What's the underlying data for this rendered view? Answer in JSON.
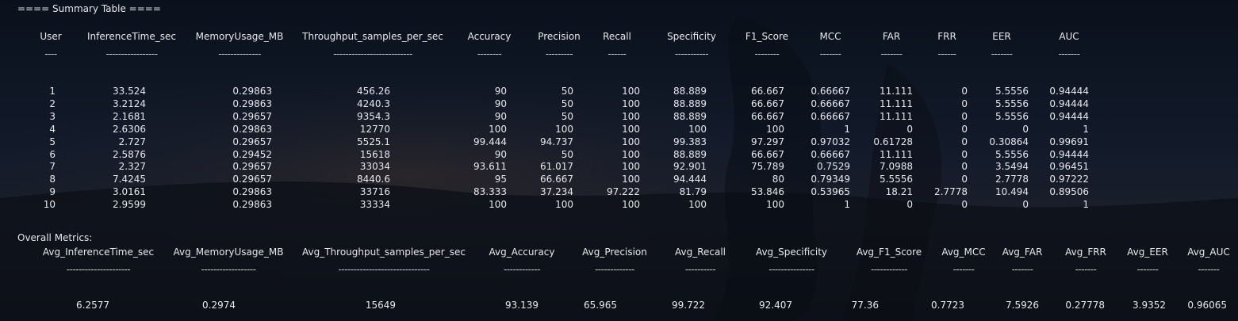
{
  "terminal": {
    "summary_header": "==== Summary Table ====",
    "overall_header": "Overall Metrics:",
    "background_color": "#0b1320",
    "text_color": "#e6e8ec"
  },
  "summary_table": {
    "columns": [
      "User",
      "InferenceTime_sec",
      "MemoryUsage_MB",
      "Throughput_samples_per_sec",
      "Accuracy",
      "Precision",
      "Recall",
      "Specificity",
      "F1_Score",
      "MCC",
      "FAR",
      "FRR",
      "EER",
      "AUC"
    ],
    "underlines": [
      "----",
      "-----------------",
      "--------------",
      "--------------------------",
      "--------",
      "---------",
      "------",
      "-----------",
      "--------",
      "-------",
      "-------",
      "------",
      "-------",
      "-------"
    ],
    "rows": [
      [
        "1",
        "33.524",
        "0.29863",
        "456.26",
        "90",
        "50",
        "100",
        "88.889",
        "66.667",
        "0.66667",
        "11.111",
        "0",
        "5.5556",
        "0.94444"
      ],
      [
        "2",
        "3.2124",
        "0.29863",
        "4240.3",
        "90",
        "50",
        "100",
        "88.889",
        "66.667",
        "0.66667",
        "11.111",
        "0",
        "5.5556",
        "0.94444"
      ],
      [
        "3",
        "2.1681",
        "0.29657",
        "9354.3",
        "90",
        "50",
        "100",
        "88.889",
        "66.667",
        "0.66667",
        "11.111",
        "0",
        "5.5556",
        "0.94444"
      ],
      [
        "4",
        "2.6306",
        "0.29863",
        "12770",
        "100",
        "100",
        "100",
        "100",
        "100",
        "1",
        "0",
        "0",
        "0",
        "1"
      ],
      [
        "5",
        "2.727",
        "0.29657",
        "5525.1",
        "99.444",
        "94.737",
        "100",
        "99.383",
        "97.297",
        "0.97032",
        "0.61728",
        "0",
        "0.30864",
        "0.99691"
      ],
      [
        "6",
        "2.5876",
        "0.29452",
        "15618",
        "90",
        "50",
        "100",
        "88.889",
        "66.667",
        "0.66667",
        "11.111",
        "0",
        "5.5556",
        "0.94444"
      ],
      [
        "7",
        "2.327",
        "0.29657",
        "33034",
        "93.611",
        "61.017",
        "100",
        "92.901",
        "75.789",
        "0.7529",
        "7.0988",
        "0",
        "3.5494",
        "0.96451"
      ],
      [
        "8",
        "7.4245",
        "0.29657",
        "8440.6",
        "95",
        "66.667",
        "100",
        "94.444",
        "80",
        "0.79349",
        "5.5556",
        "0",
        "2.7778",
        "0.97222"
      ],
      [
        "9",
        "3.0161",
        "0.29863",
        "33716",
        "83.333",
        "37.234",
        "97.222",
        "81.79",
        "53.846",
        "0.53965",
        "18.21",
        "2.7778",
        "10.494",
        "0.89506"
      ],
      [
        "10",
        "2.9599",
        "0.29863",
        "33334",
        "100",
        "100",
        "100",
        "100",
        "100",
        "1",
        "0",
        "0",
        "0",
        "1"
      ]
    ]
  },
  "overall_table": {
    "columns": [
      "Avg_InferenceTime_sec",
      "Avg_MemoryUsage_MB",
      "Avg_Throughput_samples_per_sec",
      "Avg_Accuracy",
      "Avg_Precision",
      "Avg_Recall",
      "Avg_Specificity",
      "Avg_F1_Score",
      "Avg_MCC",
      "Avg_FAR",
      "Avg_FRR",
      "Avg_EER",
      "Avg_AUC"
    ],
    "underlines": [
      "---------------------",
      "------------------",
      "------------------------------",
      "------------",
      "-------------",
      "----------",
      "---------------",
      "------------",
      "-------",
      "-------",
      "-------",
      "-------",
      "-------"
    ],
    "values": [
      "6.2577",
      "0.2974",
      "15649",
      "93.139",
      "65.965",
      "99.722",
      "92.407",
      "77.36",
      "0.7723",
      "7.5926",
      "0.27778",
      "3.9352",
      "0.96065"
    ]
  }
}
